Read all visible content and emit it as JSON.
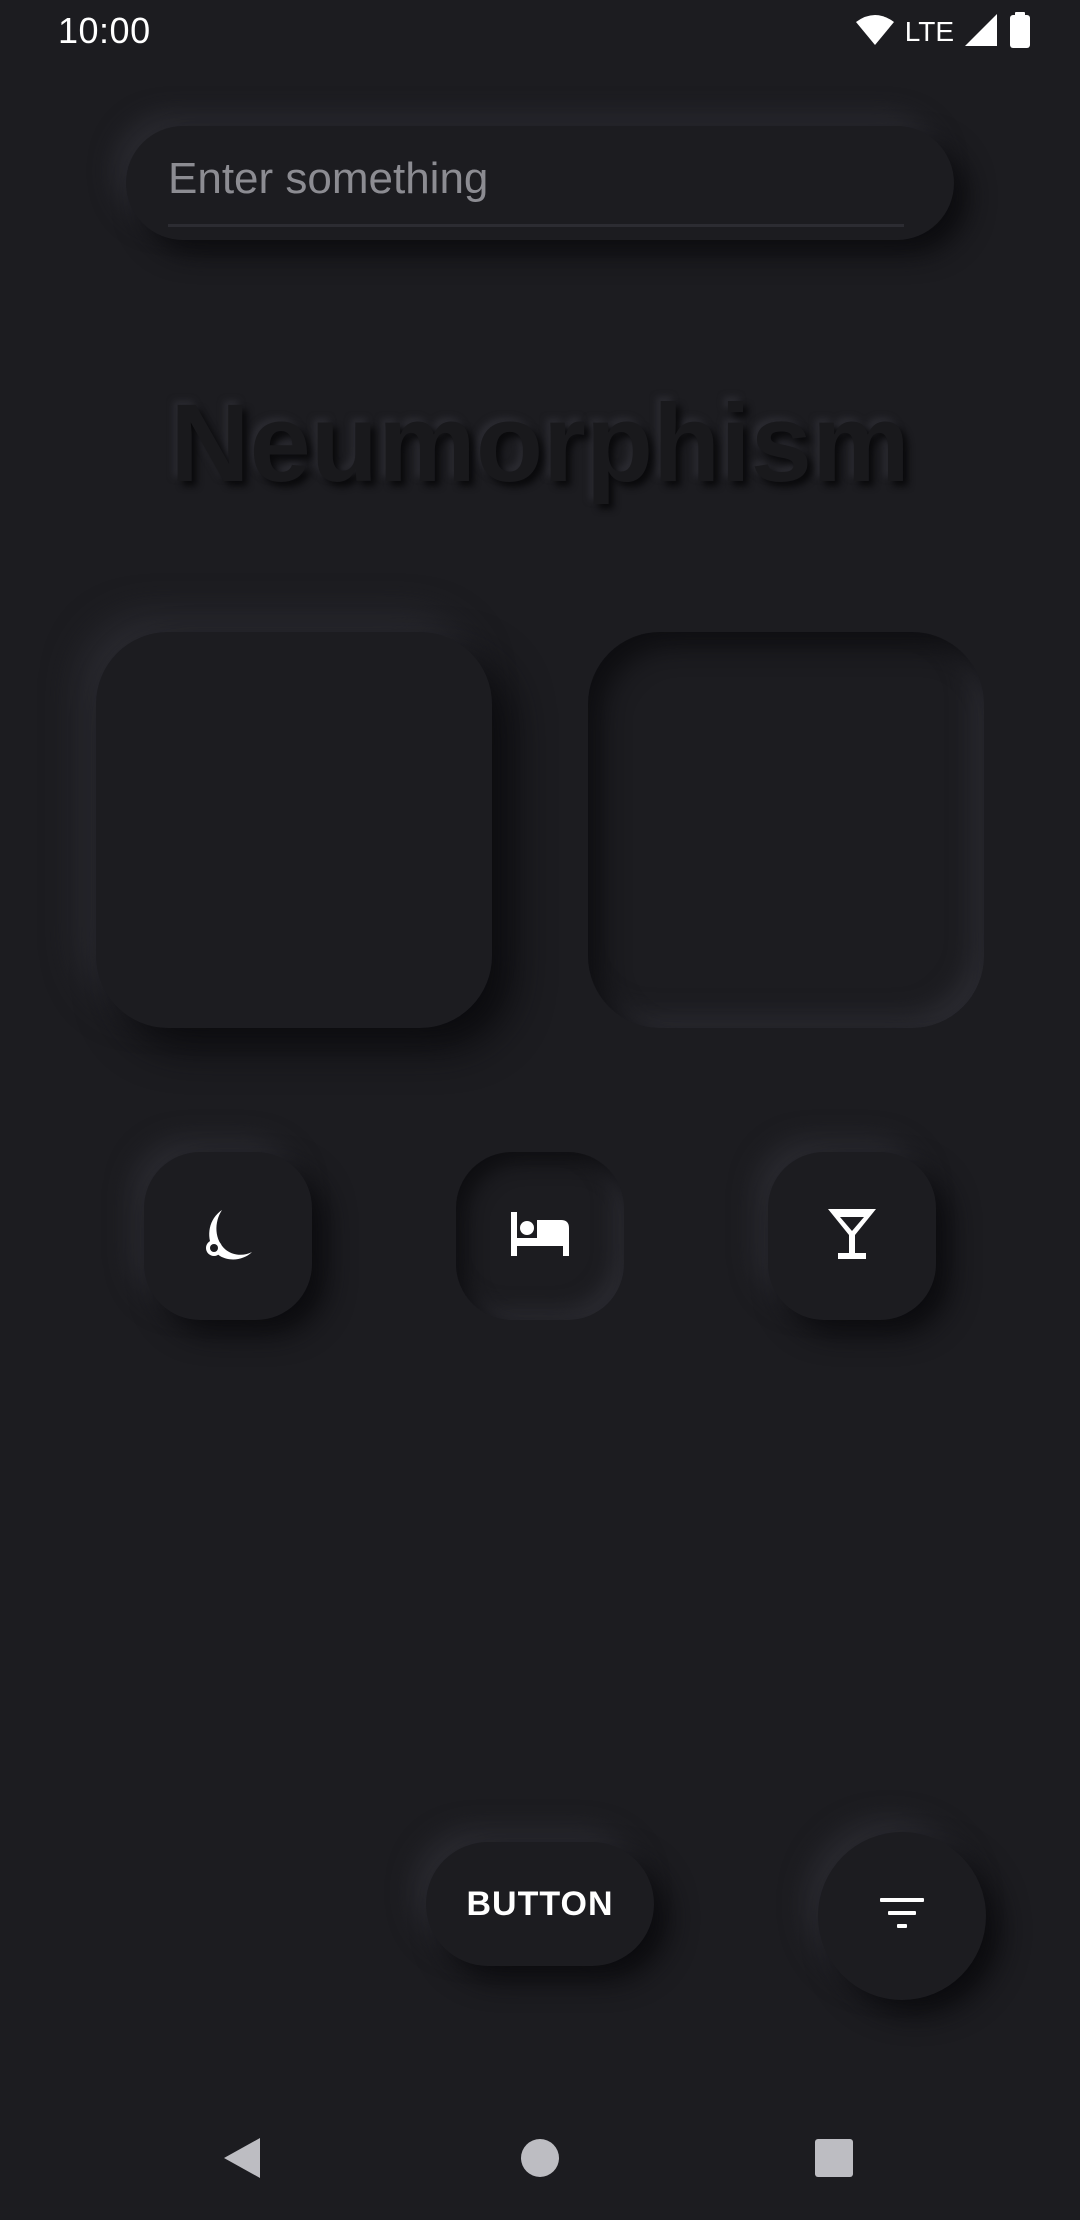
{
  "status_bar": {
    "time": "10:00",
    "network_label": "LTE",
    "icons": [
      "wifi-icon",
      "cell-signal-icon",
      "battery-icon"
    ]
  },
  "search": {
    "value": "",
    "placeholder": "Enter something"
  },
  "title": "Neumorphism",
  "cards": [
    {
      "style": "raised"
    },
    {
      "style": "inset"
    }
  ],
  "icon_buttons": [
    {
      "icon": "moon-icon",
      "style": "raised"
    },
    {
      "icon": "bed-icon",
      "style": "inset"
    },
    {
      "icon": "cocktail-icon",
      "style": "raised"
    }
  ],
  "actions": {
    "button_label": "BUTTON",
    "fab_icon": "filter-icon"
  },
  "nav_bar": {
    "items": [
      "back-icon",
      "home-icon",
      "recents-icon"
    ]
  },
  "colors": {
    "background": "#1c1c20",
    "shadow_dark": "#0b0b0e",
    "shadow_light": "#2b2b31",
    "foreground": "#ffffff"
  }
}
